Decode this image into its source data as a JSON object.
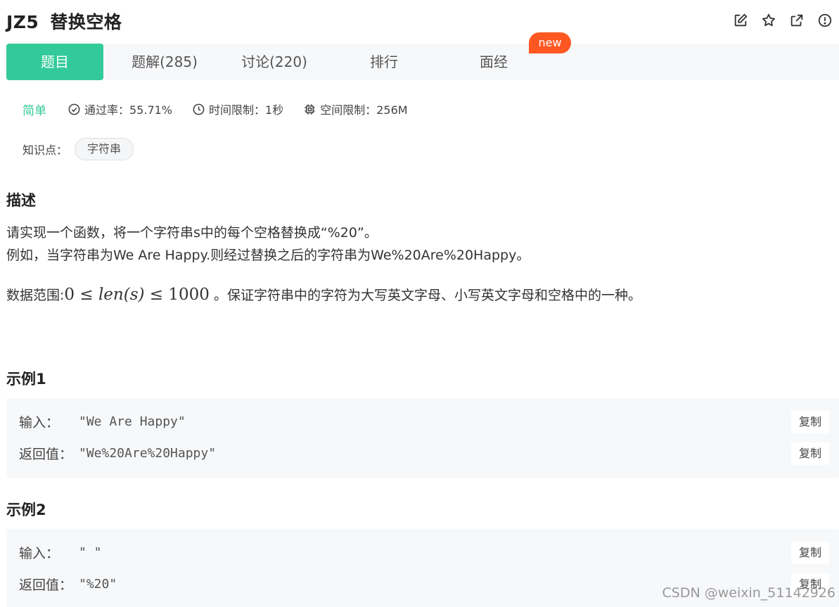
{
  "header": {
    "problem_id": "JZ5",
    "problem_title": "替换空格",
    "icons": [
      "edit-icon",
      "star-icon",
      "external-link-icon",
      "info-icon"
    ]
  },
  "tabs": [
    {
      "label": "题目",
      "active": true
    },
    {
      "label": "题解(285)",
      "active": false
    },
    {
      "label": "讨论(220)",
      "active": false
    },
    {
      "label": "排行",
      "active": false
    },
    {
      "label": "面经",
      "active": false
    }
  ],
  "new_badge": "new",
  "meta": {
    "difficulty": "简单",
    "pass_rate": "通过率：55.71%",
    "time_limit": "时间限制：1秒",
    "space_limit": "空间限制：256M"
  },
  "knowledge": {
    "label": "知识点：",
    "tag": "字符串"
  },
  "description": {
    "heading": "描述",
    "line1": "请实现一个函数，将一个字符串s中的每个空格替换成“%20”。",
    "line2": "例如，当字符串为We Are Happy.则经过替换之后的字符串为We%20Are%20Happy。",
    "range_prefix": "数据范围:",
    "range_math_lead": "0 ≤ ",
    "range_math_var": "len(s)",
    "range_math_tail": " ≤ 1000",
    "range_suffix": " 。保证字符串中的字符为大写英文字母、小写英文字母和空格中的一种。"
  },
  "examples": [
    {
      "heading": "示例1",
      "input_label": "输入：",
      "input_value": "\"We Are Happy\"",
      "output_label": "返回值：",
      "output_value": "\"We%20Are%20Happy\"",
      "copy_label": "复制"
    },
    {
      "heading": "示例2",
      "input_label": "输入：",
      "input_value": "\" \"",
      "output_label": "返回值：",
      "output_value": "\"%20\"",
      "copy_label": "复制"
    }
  ],
  "watermark": "CSDN @weixin_51142926",
  "colors": {
    "accent": "#32ca99",
    "badge": "#ff5722",
    "panel": "#f7f8fa"
  }
}
